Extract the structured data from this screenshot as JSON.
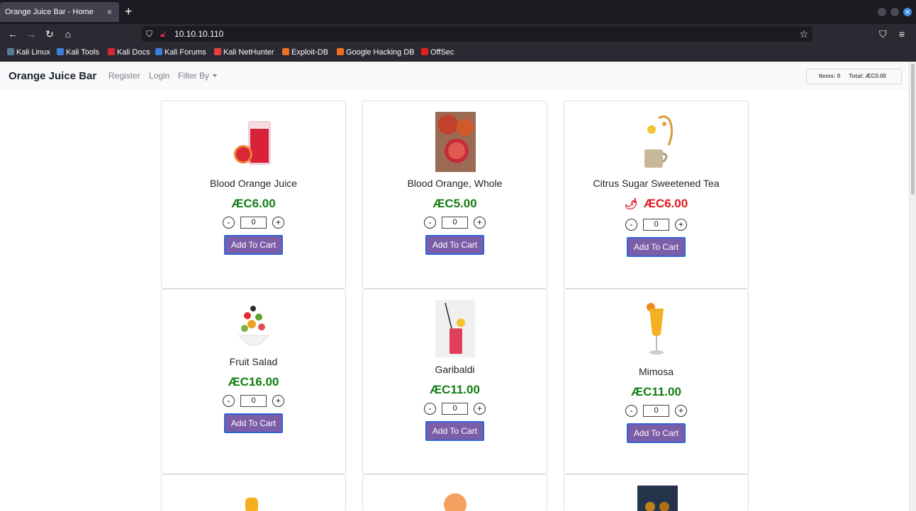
{
  "browser": {
    "tab_title": "Orange Juice Bar - Home",
    "tab_close": "×",
    "new_tab": "+",
    "url": "10.10.10.110",
    "bookmarks": [
      "Kali Linux",
      "Kali Tools",
      "Kali Docs",
      "Kali Forums",
      "Kali NetHunter",
      "Exploit-DB",
      "Google Hacking DB",
      "OffSec"
    ]
  },
  "site": {
    "brand": "Orange Juice Bar",
    "nav": {
      "register": "Register",
      "login": "Login",
      "filter": "Filter By"
    },
    "cart": {
      "items": "Items: 0",
      "total": "Total: ÆC0.00"
    }
  },
  "products": [
    {
      "name": "Blood Orange Juice",
      "price": "ÆC6.00",
      "qty": "0",
      "button": "Add To Cart"
    },
    {
      "name": "Blood Orange, Whole",
      "price": "ÆC5.00",
      "qty": "0",
      "button": "Add To Cart"
    },
    {
      "name": "Citrus Sugar Sweetened Tea",
      "price": "ÆC6.00",
      "qty": "0",
      "button": "Add To Cart"
    },
    {
      "name": "Fruit Salad",
      "price": "ÆC16.00",
      "qty": "0",
      "button": "Add To Cart"
    },
    {
      "name": "Garibaldi",
      "price": "ÆC11.00",
      "qty": "0",
      "button": "Add To Cart"
    },
    {
      "name": "Mimosa",
      "price": "ÆC11.00",
      "qty": "0",
      "button": "Add To Cart"
    }
  ],
  "qty_controls": {
    "minus": "-",
    "plus": "+"
  }
}
